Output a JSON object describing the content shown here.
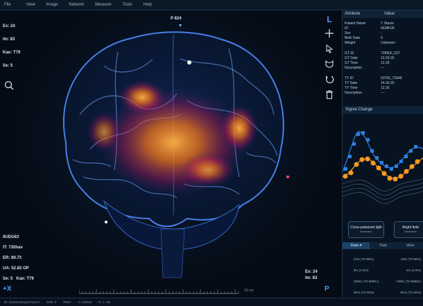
{
  "menu": [
    "File",
    "View",
    "Image",
    "Network",
    "Measure",
    "Tools",
    "Help"
  ],
  "overlay": {
    "top_left": [
      "Ex: 24",
      "Im: 83",
      "Kao: T79",
      "Se: 5"
    ],
    "top_center": "P 824",
    "bottom_left": [
      "IIUDG63",
      "IT: 730hav",
      "ER: 89.73",
      "UA: 52.82 OP"
    ],
    "bottom_left_row": [
      "Se: 5",
      "Kao: T79"
    ],
    "bottom_left_big": "+X",
    "bottom_right": [
      "Ex: 24",
      "Im: 83"
    ],
    "bottom_right_big": "P",
    "right_top_big": "L",
    "scale_label": "10 cm"
  },
  "tools": [
    "L",
    "plus-icon",
    "pointer-icon",
    "lasso-icon",
    "undo-icon",
    "trash-icon"
  ],
  "attributes": {
    "headers": [
      "Attribute",
      "Value"
    ],
    "group1": [
      {
        "k": "Patient Name",
        "v": "T. Marse"
      },
      {
        "k": "ID",
        "v": "6638HJ5"
      },
      {
        "k": "Sex",
        "v": "-"
      },
      {
        "k": "Birth Date",
        "v": "0"
      },
      {
        "k": "Weight",
        "v": "Unknown"
      }
    ],
    "group2": [
      {
        "k": "GT ID",
        "v": "7289|3I_537"
      },
      {
        "k": "GT Date",
        "v": "12.03.25"
      },
      {
        "k": "GT Time",
        "v": "12.26"
      },
      {
        "k": "Description",
        "v": "---"
      }
    ],
    "group3": [
      {
        "k": "TY ID",
        "v": "53783_72949"
      },
      {
        "k": "TY Date",
        "v": "14.03.25"
      },
      {
        "k": "TY Time",
        "v": "12.26"
      },
      {
        "k": "Description",
        "v": "---"
      }
    ]
  },
  "signal_title": "Signal Change",
  "buttons": {
    "cross": {
      "label": "Cross-polarized light",
      "sub": "illumination"
    },
    "bright": {
      "label": "Bright field",
      "sub": "illumination"
    }
  },
  "data_tabs": [
    "Data",
    "Task",
    "View"
  ],
  "data_rows": [
    {
      "a": "24% (T0-80%)",
      "b": "29% (T0-90%)"
    },
    {
      "a": "8% (1-5%)",
      "b": "4% (1-9%)"
    },
    {
      "a": "258hc (T0-89Bhc)",
      "b": "748hc (T0-89Bhc)"
    },
    {
      "a": "9K% (T0-30%)",
      "b": "8K% (T0-30%)"
    }
  ],
  "status": [
    "Dr. checkon/experiment ▾",
    "SHR: 0",
    "PR07",
    "C: 180/26",
    "P: 1 / 56"
  ],
  "colors": {
    "accent": "#3fa0ff",
    "orange": "#ff9a1f",
    "blue_series": "#2f7fe0"
  }
}
